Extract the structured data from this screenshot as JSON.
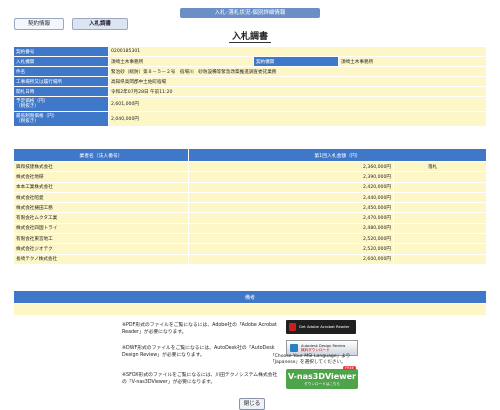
{
  "header": {
    "banner": "入札･落札状況-個別詳細情報",
    "title": "入札調書"
  },
  "tabs": [
    {
      "label": "契約情報"
    },
    {
      "label": "入札調書"
    }
  ],
  "info": {
    "contract_no": {
      "label": "契約番号",
      "value": "0200185301"
    },
    "agency": {
      "label": "入札機関",
      "value": "須崎土木事務所",
      "label2": "契約機関",
      "value2": "須崎土木事務所"
    },
    "project": {
      "label": "件名",
      "value": "緊治砂（総防）第８－５－２号　宿場川　砂防設備等緊急改築推進調査委託業務"
    },
    "location": {
      "label": "工事場所又は履行場所",
      "value": "高知県高岡郡中土佐町宿場"
    },
    "opening": {
      "label": "開札日時",
      "value": "令和2年07月28日 午前11:20"
    },
    "estimate": {
      "label": "予定価格（円）\n（税抜き）",
      "value": "2,601,000円"
    },
    "min_price": {
      "label": "最低制限価格（円）\n（税抜き）",
      "value": "2,040,000円"
    }
  },
  "bids": {
    "headers": [
      "業者名（法人番号）",
      "第1回入札金額（円）"
    ],
    "rows": [
      {
        "name": "興和技建株式会社",
        "amount": "2,360,000円",
        "note": "落札"
      },
      {
        "name": "株式会社地研",
        "amount": "2,390,000円",
        "note": ""
      },
      {
        "name": "本本工業株式会社",
        "amount": "2,420,000円",
        "note": ""
      },
      {
        "name": "株式会社昭愛",
        "amount": "2,440,000円",
        "note": ""
      },
      {
        "name": "株式会社樋田工務",
        "amount": "2,450,000円",
        "note": ""
      },
      {
        "name": "有限会社ムクタ工業",
        "amount": "2,470,000円",
        "note": ""
      },
      {
        "name": "株式会社四国トライ",
        "amount": "2,480,000円",
        "note": ""
      },
      {
        "name": "有限会社東宮地工",
        "amount": "2,520,000円",
        "note": ""
      },
      {
        "name": "株式会社ジオテク",
        "amount": "2,520,000円",
        "note": ""
      },
      {
        "name": "長崎テクノ株式会社",
        "amount": "2,600,000円",
        "note": ""
      }
    ]
  },
  "remarks": {
    "header": "備考",
    "text": ""
  },
  "notes": {
    "pdf": "※PDF形式のファイルをご覧になるには、Adobe社の「Adobe Acrobat Reader」が必要になります。",
    "dwf": "※DWF形式のファイルをご覧になるには、AutoDesk社の「AutoDesk Design Review」が必要になります。",
    "dwf_extra": "「Choose Your MSI Language」より「Japanese」を選択してください。",
    "sfx": "※SFOX形式のファイルをご覧になるには、川田テクノシステム株式会社の「V-nas3DViewer」が必要になります。"
  },
  "logos": {
    "adobe": "Get Adobe Acrobat Reader",
    "autodesk_line1": "Autodesk Design Review",
    "autodesk_line2": "無料ダウンロード",
    "vnas_line1": "V-nas3DViewer",
    "vnas_line2": "ダウンロードはこちら",
    "vnas_badge": "FREE"
  },
  "buttons": {
    "close": "閉じる"
  }
}
